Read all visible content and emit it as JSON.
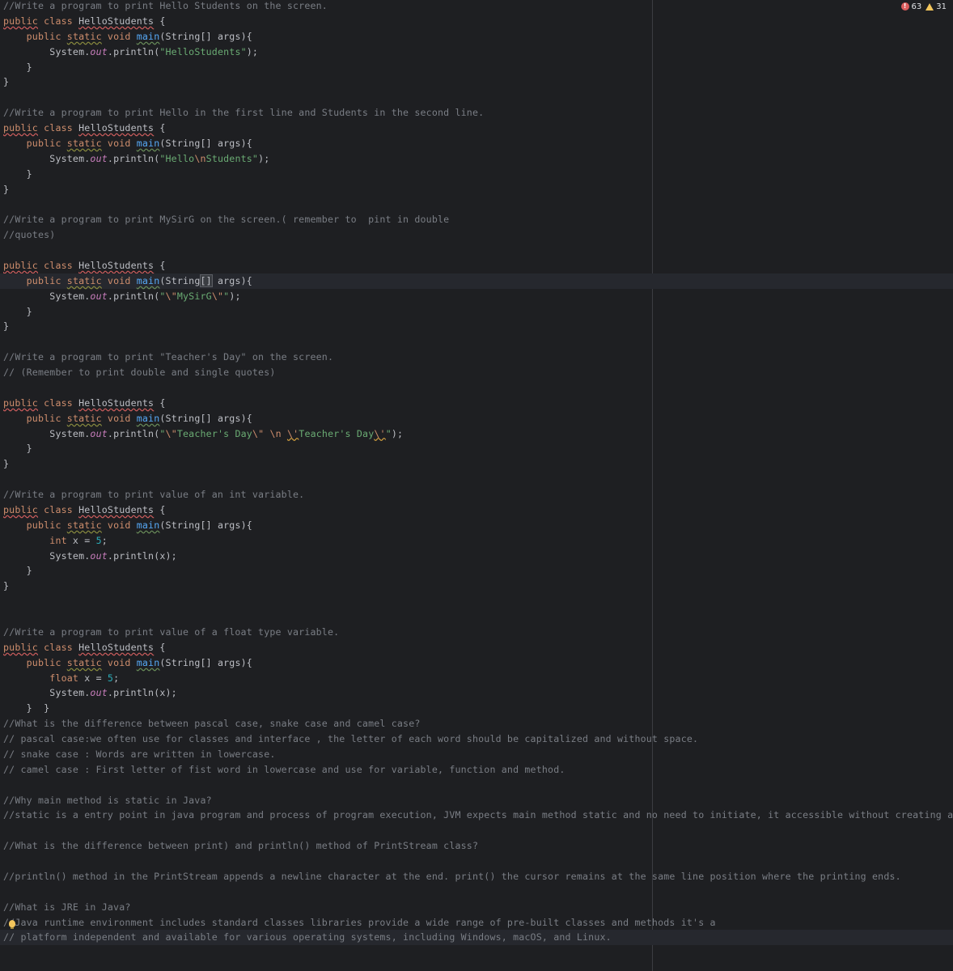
{
  "inspections": {
    "errors": "63",
    "warnings": "31"
  },
  "lines": [
    [
      [
        "cm",
        "//Write a program to print Hello Students on the screen."
      ]
    ],
    [
      [
        "kwr",
        "public"
      ],
      [
        "t",
        " "
      ],
      [
        "kw",
        "class"
      ],
      [
        "t",
        " "
      ],
      [
        "cls",
        "HelloStudents"
      ],
      [
        "t",
        " {"
      ]
    ],
    [
      [
        "t",
        "    "
      ],
      [
        "kw",
        "public"
      ],
      [
        "t",
        " "
      ],
      [
        "kwu",
        "static"
      ],
      [
        "t",
        " "
      ],
      [
        "kw",
        "void"
      ],
      [
        "t",
        " "
      ],
      [
        "fn",
        "main"
      ],
      [
        "t",
        "(String[] args){"
      ]
    ],
    [
      [
        "t",
        "        System."
      ],
      [
        "fld",
        "out"
      ],
      [
        "t",
        "."
      ],
      [
        "mth",
        "println"
      ],
      [
        "t",
        "("
      ],
      [
        "str",
        "\"HelloStudents\""
      ],
      [
        "t",
        ");"
      ]
    ],
    [
      [
        "t",
        "    }"
      ]
    ],
    [
      [
        "t",
        "}"
      ]
    ],
    [
      [
        "t",
        ""
      ]
    ],
    [
      [
        "cm",
        "//Write a program to print Hello in the first line and Students in the second line."
      ]
    ],
    [
      [
        "kwr",
        "public"
      ],
      [
        "t",
        " "
      ],
      [
        "kw",
        "class"
      ],
      [
        "t",
        " "
      ],
      [
        "cls",
        "HelloStudents"
      ],
      [
        "t",
        " {"
      ]
    ],
    [
      [
        "t",
        "    "
      ],
      [
        "kw",
        "public"
      ],
      [
        "t",
        " "
      ],
      [
        "kwu",
        "static"
      ],
      [
        "t",
        " "
      ],
      [
        "kw",
        "void"
      ],
      [
        "t",
        " "
      ],
      [
        "fn",
        "main"
      ],
      [
        "t",
        "(String[] args){"
      ]
    ],
    [
      [
        "t",
        "        System."
      ],
      [
        "fld",
        "out"
      ],
      [
        "t",
        "."
      ],
      [
        "mth",
        "println"
      ],
      [
        "t",
        "("
      ],
      [
        "str",
        "\"Hello"
      ],
      [
        "esc",
        "\\n"
      ],
      [
        "str",
        "Students\""
      ],
      [
        "t",
        ");"
      ]
    ],
    [
      [
        "t",
        "    }"
      ]
    ],
    [
      [
        "t",
        "}"
      ]
    ],
    [
      [
        "t",
        ""
      ]
    ],
    [
      [
        "cm",
        "//Write a program to print MySirG on the screen.( remember to  pint in double"
      ]
    ],
    [
      [
        "cm",
        "//quotes)"
      ]
    ],
    [
      [
        "t",
        ""
      ]
    ],
    [
      [
        "kwr",
        "public"
      ],
      [
        "t",
        " "
      ],
      [
        "kw",
        "class"
      ],
      [
        "t",
        " "
      ],
      [
        "cls",
        "HelloStudents"
      ],
      [
        "t",
        " {"
      ]
    ],
    [
      [
        "t",
        "    "
      ],
      [
        "kw",
        "public"
      ],
      [
        "t",
        " "
      ],
      [
        "kwu",
        "static"
      ],
      [
        "t",
        " "
      ],
      [
        "kw",
        "void"
      ],
      [
        "t",
        " "
      ],
      [
        "fn",
        "main"
      ],
      [
        "t",
        "(String"
      ],
      [
        "bm",
        "[]"
      ],
      [
        "t",
        " args){"
      ]
    ],
    [
      [
        "t",
        "        System."
      ],
      [
        "fld",
        "out"
      ],
      [
        "t",
        "."
      ],
      [
        "mth",
        "println"
      ],
      [
        "t",
        "("
      ],
      [
        "str",
        "\""
      ],
      [
        "esc",
        "\\\""
      ],
      [
        "str",
        "MySirG"
      ],
      [
        "esc",
        "\\\""
      ],
      [
        "str",
        "\""
      ],
      [
        "t",
        ");"
      ]
    ],
    [
      [
        "t",
        "    }"
      ]
    ],
    [
      [
        "t",
        "}"
      ]
    ],
    [
      [
        "t",
        ""
      ]
    ],
    [
      [
        "cm",
        "//Write a program to print \"Teacher's Day\" on the screen."
      ]
    ],
    [
      [
        "cm",
        "// (Remember to print double and single quotes)"
      ]
    ],
    [
      [
        "t",
        ""
      ]
    ],
    [
      [
        "kwr",
        "public"
      ],
      [
        "t",
        " "
      ],
      [
        "kw",
        "class"
      ],
      [
        "t",
        " "
      ],
      [
        "cls",
        "HelloStudents"
      ],
      [
        "t",
        " {"
      ]
    ],
    [
      [
        "t",
        "    "
      ],
      [
        "kw",
        "public"
      ],
      [
        "t",
        " "
      ],
      [
        "kwu",
        "static"
      ],
      [
        "t",
        " "
      ],
      [
        "kw",
        "void"
      ],
      [
        "t",
        " "
      ],
      [
        "fn",
        "main"
      ],
      [
        "t",
        "(String[] args){"
      ]
    ],
    [
      [
        "t",
        "        System."
      ],
      [
        "fld",
        "out"
      ],
      [
        "t",
        "."
      ],
      [
        "mth",
        "println"
      ],
      [
        "t",
        "("
      ],
      [
        "str",
        "\""
      ],
      [
        "esc",
        "\\\""
      ],
      [
        "str",
        "Teacher's Day"
      ],
      [
        "esc",
        "\\\""
      ],
      [
        "str",
        " "
      ],
      [
        "esc",
        "\\n"
      ],
      [
        "str",
        " "
      ],
      [
        "escw",
        "\\'"
      ],
      [
        "str",
        "Teacher's Day"
      ],
      [
        "escw",
        "\\'"
      ],
      [
        "str",
        "\""
      ],
      [
        "t",
        ");"
      ]
    ],
    [
      [
        "t",
        "    }"
      ]
    ],
    [
      [
        "t",
        "}"
      ]
    ],
    [
      [
        "t",
        ""
      ]
    ],
    [
      [
        "cm",
        "//Write a program to print value of an int variable."
      ]
    ],
    [
      [
        "kwr",
        "public"
      ],
      [
        "t",
        " "
      ],
      [
        "kw",
        "class"
      ],
      [
        "t",
        " "
      ],
      [
        "cls",
        "HelloStudents"
      ],
      [
        "t",
        " {"
      ]
    ],
    [
      [
        "t",
        "    "
      ],
      [
        "kw",
        "public"
      ],
      [
        "t",
        " "
      ],
      [
        "kwu",
        "static"
      ],
      [
        "t",
        " "
      ],
      [
        "kw",
        "void"
      ],
      [
        "t",
        " "
      ],
      [
        "fn",
        "main"
      ],
      [
        "t",
        "(String[] args){"
      ]
    ],
    [
      [
        "t",
        "        "
      ],
      [
        "kw",
        "int"
      ],
      [
        "t",
        " x = "
      ],
      [
        "num",
        "5"
      ],
      [
        "t",
        ";"
      ]
    ],
    [
      [
        "t",
        "        System."
      ],
      [
        "fld",
        "out"
      ],
      [
        "t",
        "."
      ],
      [
        "mth",
        "println"
      ],
      [
        "t",
        "(x);"
      ]
    ],
    [
      [
        "t",
        "    }"
      ]
    ],
    [
      [
        "t",
        "}"
      ]
    ],
    [
      [
        "t",
        ""
      ]
    ],
    [
      [
        "t",
        ""
      ]
    ],
    [
      [
        "cm",
        "//Write a program to print value of a float type variable."
      ]
    ],
    [
      [
        "kwr",
        "public"
      ],
      [
        "t",
        " "
      ],
      [
        "kw",
        "class"
      ],
      [
        "t",
        " "
      ],
      [
        "cls",
        "HelloStudents"
      ],
      [
        "t",
        " {"
      ]
    ],
    [
      [
        "t",
        "    "
      ],
      [
        "kw",
        "public"
      ],
      [
        "t",
        " "
      ],
      [
        "kwu",
        "static"
      ],
      [
        "t",
        " "
      ],
      [
        "kw",
        "void"
      ],
      [
        "t",
        " "
      ],
      [
        "fn",
        "main"
      ],
      [
        "t",
        "(String[] args){"
      ]
    ],
    [
      [
        "t",
        "        "
      ],
      [
        "kw",
        "float"
      ],
      [
        "t",
        " x = "
      ],
      [
        "num",
        "5"
      ],
      [
        "t",
        ";"
      ]
    ],
    [
      [
        "t",
        "        System."
      ],
      [
        "fld",
        "out"
      ],
      [
        "t",
        "."
      ],
      [
        "mth",
        "println"
      ],
      [
        "t",
        "(x);"
      ]
    ],
    [
      [
        "t",
        "    }  }"
      ]
    ],
    [
      [
        "cm",
        "//What is the difference between pascal case, snake case and camel case?"
      ]
    ],
    [
      [
        "cm",
        "// pascal case:we often use for classes and interface , the letter of each word should be capitalized and without space."
      ]
    ],
    [
      [
        "cm",
        "// snake case : Words are written in lowercase."
      ]
    ],
    [
      [
        "cm",
        "// camel case : First letter of fist word in lowercase and use for variable, function and method."
      ]
    ],
    [
      [
        "t",
        ""
      ]
    ],
    [
      [
        "cm",
        "//Why main method is static in Java?"
      ]
    ],
    [
      [
        "cm",
        "//static is a entry point in java program and process of program execution, JVM expects main method static and no need to initiate, it accessible without creating an object of"
      ]
    ],
    [
      [
        "t",
        ""
      ]
    ],
    [
      [
        "cm",
        "//What is the difference between print) and println() method of PrintStream class?"
      ]
    ],
    [
      [
        "t",
        ""
      ]
    ],
    [
      [
        "cm",
        "//println() method in the PrintStream appends a newline character at the end. print() the cursor remains at the same line position where the printing ends."
      ]
    ],
    [
      [
        "t",
        ""
      ]
    ],
    [
      [
        "cm",
        "//What is JRE in Java?"
      ]
    ],
    [
      [
        "cm",
        "//Java runtime environment includes standard classes libraries provide a wide range of pre-built classes and methods it's a"
      ]
    ],
    [
      [
        "cm",
        "// platform independent and available for various operating systems, including Windows, macOS, and Linux."
      ]
    ]
  ],
  "current_lines": [
    18,
    61
  ]
}
